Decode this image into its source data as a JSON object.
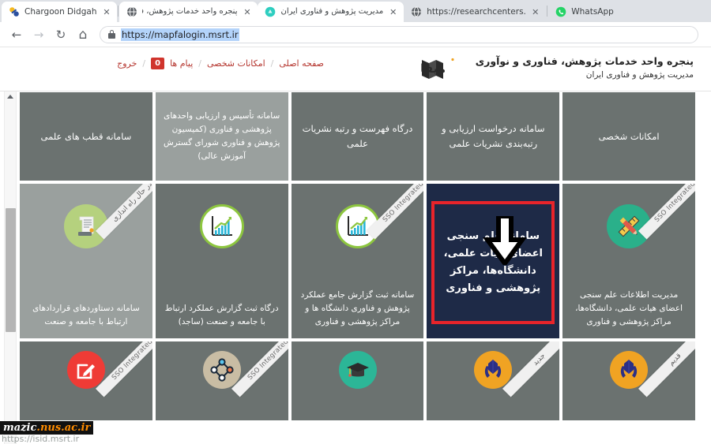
{
  "browser": {
    "tabs": [
      {
        "title": "Chargoon Didgah",
        "favicon": "chargoon-icon",
        "rtl": false,
        "active": false,
        "close": "✕"
      },
      {
        "title": "پنجره واحد خدمات پژوهش، فناوری و نو",
        "favicon": "globe-icon",
        "rtl": true,
        "active": false,
        "close": "✕"
      },
      {
        "title": "مدیریت پژوهش و فناوری ایران",
        "favicon": "msrt-icon",
        "rtl": true,
        "active": true,
        "close": "✕"
      },
      {
        "title": "https://researchcenters.msrt.ir/",
        "favicon": "globe-icon",
        "rtl": false,
        "active": false,
        "close": "✕"
      },
      {
        "title": "WhatsApp",
        "favicon": "whatsapp-icon",
        "rtl": false,
        "active": false,
        "close": ""
      }
    ],
    "toolbar": {
      "back": "←",
      "forward": "→",
      "reload": "↻",
      "home": "⌂",
      "url": "https://mapfalogin.msrt.ir",
      "lock": "lock-icon"
    }
  },
  "site": {
    "brand_title": "پنجره واحد خدمات پژوهش، فناوری و نوآوری",
    "brand_sub": "مدیریت پژوهش و فناوری ایران",
    "logo": "msrt-book-logo",
    "nav": [
      {
        "label": "صفحه اصلی",
        "badge": null
      },
      {
        "label": "امکانات شخصی",
        "badge": null
      },
      {
        "label": "پیام ها",
        "badge": "0"
      },
      {
        "label": "خروج",
        "badge": null
      }
    ],
    "nav_separator": "/"
  },
  "grid": {
    "rows": [
      {
        "id": "row-1",
        "tiles": [
          {
            "title": "امکانات شخصی",
            "shade": "dark",
            "ribbon": null,
            "icon": null
          },
          {
            "title": "سامانه درخواست ارزیابی و رتبه‌بندی نشریات علمی",
            "shade": "dark",
            "ribbon": null,
            "icon": null
          },
          {
            "title": "درگاه فهرست و رتبه نشریات علمی",
            "shade": "dark",
            "ribbon": null,
            "icon": null
          },
          {
            "title": "سامانه تأسیس و ارزیابی واحدهای پژوهشی و فناوری (کمیسیون پژوهش و فناوری شورای گسترش آموزش عالی)",
            "shade": "light",
            "ribbon": null,
            "icon": null
          },
          {
            "title": "سامانه قطب های علمی",
            "shade": "dark",
            "ribbon": null,
            "icon": null
          }
        ]
      },
      {
        "id": "row-2",
        "tiles": [
          {
            "title": "مدیریت اطلاعات علم سنجی اعضای هیات علمی، دانشگاه‌ها، مراکز پژوهشی و فناوری",
            "shade": "dark",
            "ribbon": "SSO Integrated",
            "ribbon_lang": "en",
            "icon": "ruler-pencil-icon",
            "icon_bg": "#2ab08a"
          },
          {
            "title": "سامانه علم سنجی اعضای هیات علمی، دانشگاه‌ها، مراکز پژوهشی و فناوری",
            "shade": "highlight",
            "ribbon": null,
            "icon": null
          },
          {
            "title": "سامانه ثبت گزارش جامع عملکرد پژوهش و فناوری دانشگاه ها و مراکز پژوهشی و فناوری",
            "shade": "dark",
            "ribbon": "SSO Integrated",
            "ribbon_lang": "en",
            "icon": "bar-chart-icon",
            "icon_bg": "#ffffff"
          },
          {
            "title": "درگاه ثبت گزارش عملکرد ارتباط با جامعه و صنعت (ساجد)",
            "shade": "dark",
            "ribbon": null,
            "icon": "bar-chart-icon",
            "icon_bg": "#ffffff"
          },
          {
            "title": "سامانه دستاوردهای قراردادهای ارتباط با جامعه و صنعت",
            "shade": "light",
            "ribbon": "در حال راه اندازی",
            "ribbon_lang": "fa",
            "icon": "scroll-document-icon",
            "icon_bg": "#b5d17e"
          }
        ]
      },
      {
        "id": "row-3",
        "tiles": [
          {
            "title": "",
            "shade": "dark",
            "ribbon": "قدیم",
            "ribbon_lang": "fa",
            "icon": "wheat-hands-icon",
            "icon_bg": "#f0a323"
          },
          {
            "title": "",
            "shade": "dark",
            "ribbon": "جدید",
            "ribbon_lang": "fa",
            "icon": "wheat-hands-icon",
            "icon_bg": "#f0a323"
          },
          {
            "title": "",
            "shade": "dark",
            "ribbon": null,
            "icon": "graduation-cap-icon",
            "icon_bg": "#2cb697"
          },
          {
            "title": "",
            "shade": "dark",
            "ribbon": "SSO Integrated",
            "ribbon_lang": "en",
            "icon": "network-nodes-icon",
            "icon_bg": "#c9bda4"
          },
          {
            "title": "",
            "shade": "dark",
            "ribbon": "SSO Integrated",
            "ribbon_lang": "en",
            "icon": "edit-square-icon",
            "icon_bg": "#ef3b36"
          }
        ]
      }
    ]
  },
  "annotation": {
    "arrow": "down-arrow-pointer",
    "target_tile": "سامانه علم سنجی اعضای هیات علمی، دانشگاه‌ها، مراکز پژوهشی و فناوری",
    "highlight_color": "#e8242a"
  },
  "watermark": {
    "line1_a": "mazic",
    "line1_b": ".nus.ac.ir",
    "line2": "https://isid.msrt.ir"
  }
}
